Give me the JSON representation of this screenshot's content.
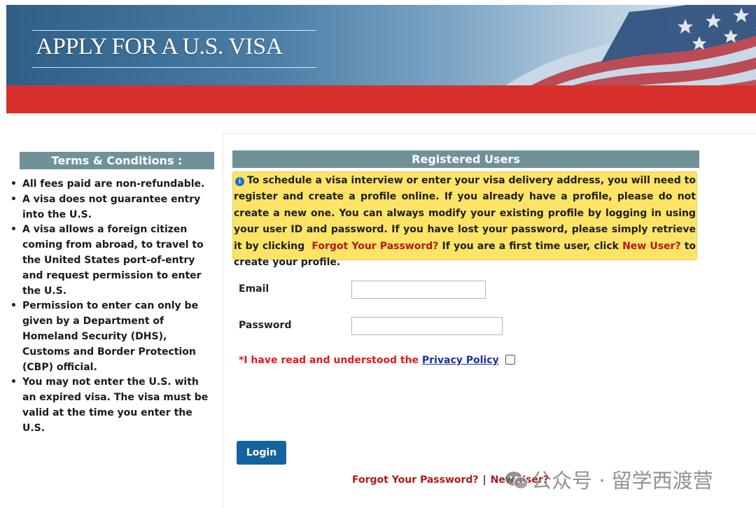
{
  "banner": {
    "title": "APPLY FOR A U.S. VISA"
  },
  "terms": {
    "header": "Terms & Conditions :",
    "items": [
      "All fees paid are non-refundable.",
      "A visa does not guarantee entry into the U.S.",
      "A visa allows a foreign citizen coming from abroad, to travel to the United States port-of-entry and request permission to enter the U.S.",
      "Permission to enter can only be given by a Department of Homeland Security (DHS), Customs and Border Protection (CBP) official.",
      "You may not enter the U.S. with an expired visa. The visa must be valid at the time you enter the U.S."
    ]
  },
  "registered": {
    "header": "Registered Users",
    "info_icon": "info-icon",
    "info_text": "To schedule a visa interview or enter your visa delivery address, you will need to register and create a profile online. If you already have a profile, please do not create a new one. You can always modify your existing profile by logging in using your user ID and password. If you have lost your password, please simply retrieve it by clicking",
    "info_link_forgot": "Forgot Your Password?",
    "info_text_mid": "If you are a first time user, click",
    "info_link_new": "New User?",
    "info_text_end": "to create your profile."
  },
  "form": {
    "email_label": "Email",
    "email_value": "",
    "password_label": "Password",
    "password_value": "",
    "privacy_prefix": "*I have read and understood the",
    "privacy_link": "Privacy Policy",
    "privacy_checked": false,
    "login_label": "Login"
  },
  "footer_links": {
    "forgot": "Forgot Your Password?",
    "separator": "|",
    "new_user": "New User?"
  },
  "watermark": {
    "icon": "wechat-icon",
    "text": "公众号 · 留学西渡营"
  },
  "colors": {
    "red_bar": "#d8312d",
    "section_header": "#6f9298",
    "info_box": "#fde466",
    "login_button": "#15639e",
    "link_red": "#b01919",
    "privacy_red": "#e8161b"
  }
}
